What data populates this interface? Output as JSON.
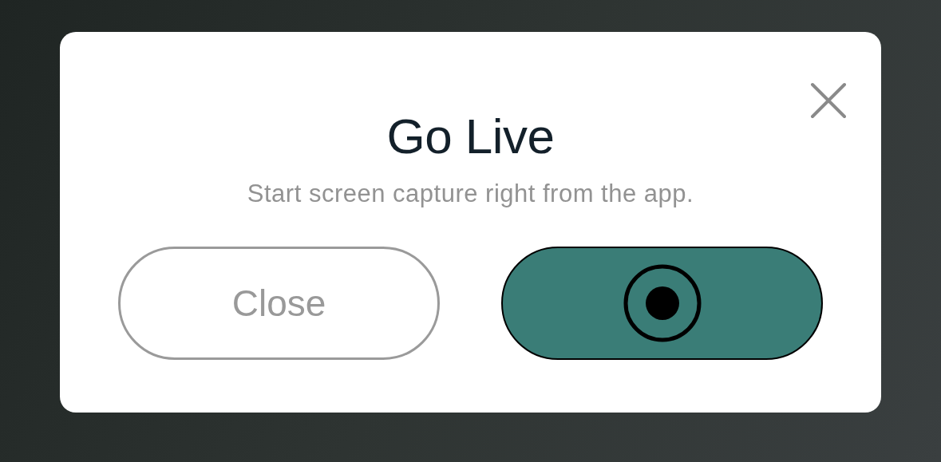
{
  "dialog": {
    "title": "Go Live",
    "subtitle": "Start screen capture right from the app.",
    "buttons": [
      {
        "kind": "secondary",
        "label": "Close"
      },
      {
        "kind": "record"
      }
    ]
  }
}
